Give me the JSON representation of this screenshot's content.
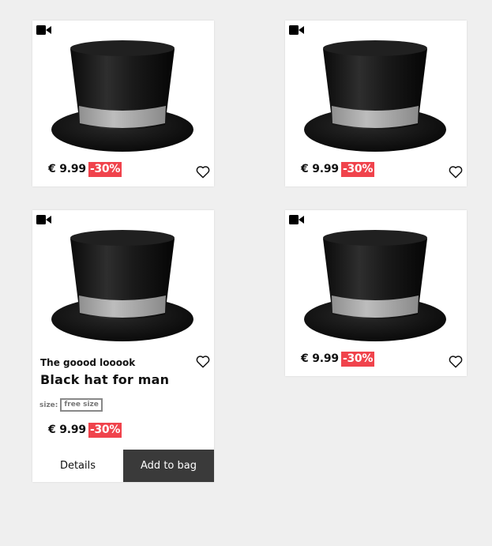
{
  "products": [
    {
      "price": "€ 9.99",
      "discount": "-30%",
      "video_icon": "video-camera-icon",
      "favorite_icon": "heart-outline-icon"
    },
    {
      "price": "€ 9.99",
      "discount": "-30%",
      "video_icon": "video-camera-icon",
      "favorite_icon": "heart-outline-icon"
    },
    {
      "brand": "The goood looook",
      "title": "Black hat for man",
      "size_label": "size:",
      "size_value": "free size",
      "price": "€ 9.99",
      "discount": "-30%",
      "details_label": "Details",
      "add_to_bag_label": "Add to bag",
      "video_icon": "video-camera-icon",
      "favorite_icon": "heart-outline-icon"
    },
    {
      "price": "€ 9.99",
      "discount": "-30%",
      "video_icon": "video-camera-icon",
      "favorite_icon": "heart-outline-icon"
    }
  ],
  "colors": {
    "discount_bg": "#f0434c",
    "add_to_bag_bg": "#3a3a3a",
    "page_bg": "#efefef"
  }
}
